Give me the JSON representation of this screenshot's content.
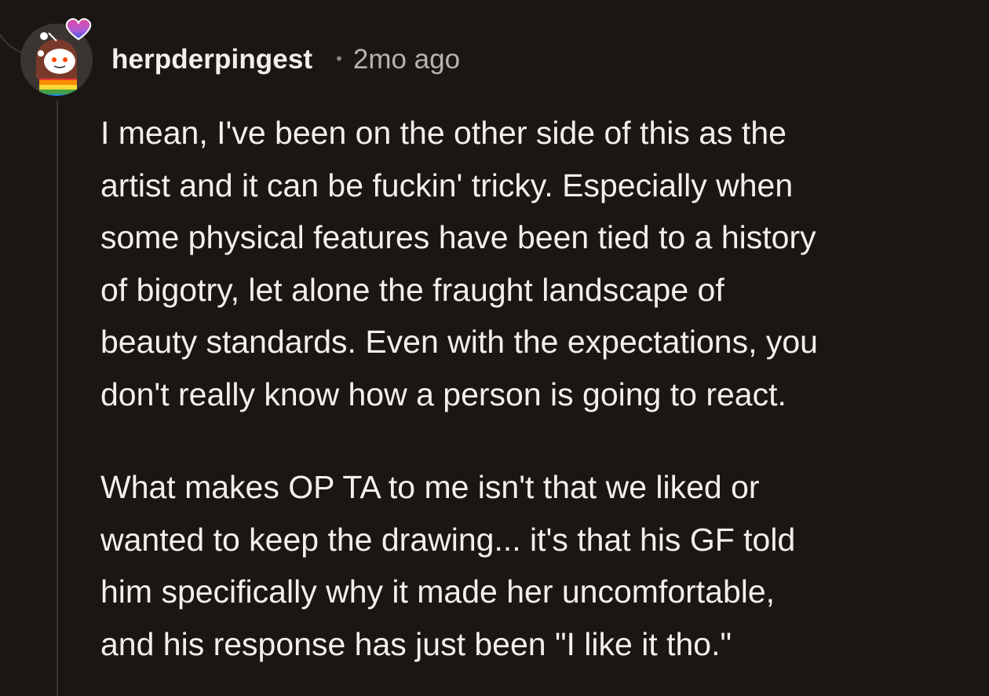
{
  "comment": {
    "author": "herpderpingest",
    "separator": "•",
    "time": "2mo ago",
    "avatar_icon": "avatar-snoo-rainbow-icon",
    "badge_icon": "bisexual-heart-icon",
    "paragraphs": [
      {
        "lines": [
          "I mean, I've been on the other side of this as the",
          "artist and it can be fuckin' tricky. Especially when",
          "some physical features have been tied to a history",
          "of bigotry, let alone the fraught landscape of",
          "beauty standards. Even with the expectations, you",
          "don't really know how a person is going to react."
        ]
      },
      {
        "lines": [
          "What makes OP TA to me isn't that we liked or",
          "wanted to keep the drawing... it's that his GF told",
          "him specifically why it made her uncomfortable,",
          "and his response has just been \"I like it tho.\""
        ]
      }
    ]
  },
  "colors": {
    "background": "#1a1614",
    "text": "#f2efed",
    "muted": "#b9b3ae",
    "thread": "#3a3533"
  }
}
